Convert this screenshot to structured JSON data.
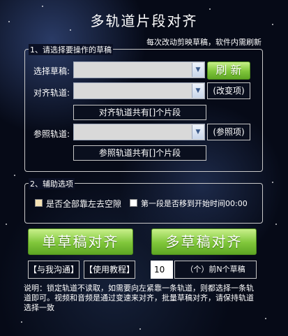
{
  "title": "多轨道片段对齐",
  "hint": "每次改动剪映草稿，软件内需刷新",
  "draft_group": {
    "legend": "1、请选择要操作的草稿",
    "select_draft_label": "选择草稿:",
    "refresh_label": "刷 新",
    "align_track_label": "对齐轨道:",
    "align_change_label": "(改变项)",
    "align_count_text": "对齐轨道共有[]个片段",
    "ref_track_label": "参照轨道:",
    "ref_label": "(参照项)",
    "ref_count_text": "参照轨道共有[]个片段"
  },
  "aux_group": {
    "legend": "2、辅助选项",
    "opt1_label": "是否全部靠左去空隙",
    "opt2_label": "第一段是否移到开始时间00:00"
  },
  "actions": {
    "single_label": "单草稿对齐",
    "multi_label": "多草稿对齐",
    "contact_label": "【与我沟通】",
    "tutorial_label": "【使用教程】",
    "count_value": "10",
    "count_suffix": "（个）前N个草稿"
  },
  "description": "说明：锁定轨道不读取，如需要向左紧靠一条轨道，则都选择一条轨道即可。视频和音频是通过变速来对齐，批量草稿对齐，请保持轨道选择一致",
  "colors": {
    "accent_green": "#7fc63a",
    "background": "#060a17"
  }
}
